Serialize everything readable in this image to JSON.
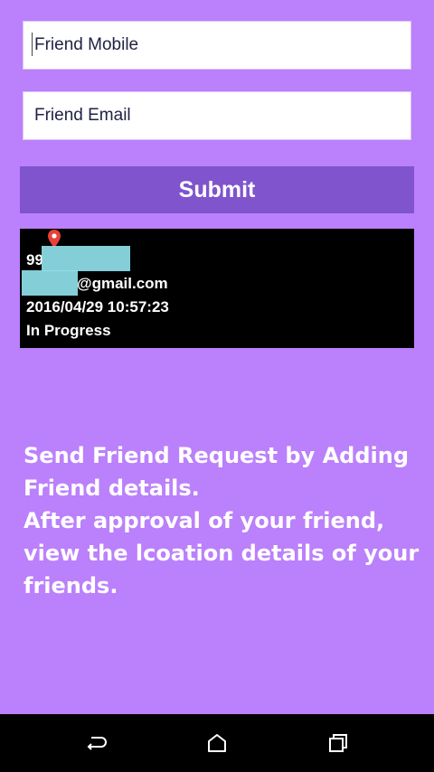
{
  "form": {
    "mobile_placeholder": "Friend Mobile",
    "email_placeholder": "Friend Email",
    "submit_label": "Submit"
  },
  "request_card": {
    "mobile_prefix": "99",
    "email_suffix": "@gmail.com",
    "timestamp": "2016/04/29 10:57:23",
    "status": "In Progress"
  },
  "info": {
    "line1": "Send Friend Request by Adding Friend details.",
    "line2": "After approval of your friend, view the lcoation details of your friends."
  },
  "colors": {
    "background": "#bb80fb",
    "button": "#7f54cc",
    "card": "#000000",
    "redaction": "#8fe0ea",
    "pin": "#e8413a"
  },
  "icons": {
    "location": "map-pin-icon",
    "back": "back-icon",
    "home": "home-icon",
    "recents": "recents-icon"
  }
}
